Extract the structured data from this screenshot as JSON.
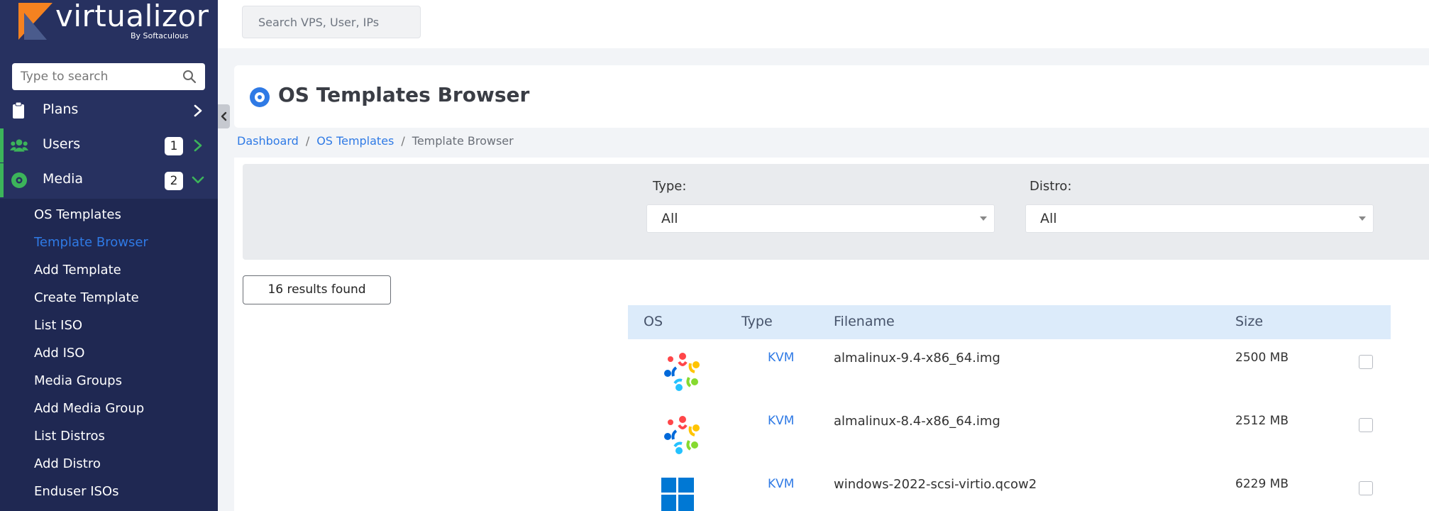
{
  "sidebar": {
    "brand": "virtualizor",
    "brand_sub": "By Softaculous",
    "search_placeholder": "Type to search",
    "nav": [
      {
        "label": "Plans",
        "icon": "clipboard-icon"
      },
      {
        "label": "Users",
        "icon": "users-icon",
        "badge": "1"
      },
      {
        "label": "Media",
        "icon": "disc-icon",
        "badge": "2"
      }
    ],
    "submenu": [
      {
        "label": "OS Templates"
      },
      {
        "label": "Template Browser",
        "active": true
      },
      {
        "label": "Add Template"
      },
      {
        "label": "Create Template"
      },
      {
        "label": "List ISO"
      },
      {
        "label": "Add ISO"
      },
      {
        "label": "Media Groups"
      },
      {
        "label": "Add Media Group"
      },
      {
        "label": "List Distros"
      },
      {
        "label": "Add Distro"
      },
      {
        "label": "Enduser ISOs"
      }
    ]
  },
  "topbar": {
    "search_placeholder": "Search VPS, User, IPs"
  },
  "page": {
    "title": "OS Templates Browser",
    "breadcrumb": [
      "Dashboard",
      "OS Templates",
      "Template Browser"
    ]
  },
  "filters": {
    "type_label": "Type:",
    "type_value": "All",
    "distro_label": "Distro:",
    "distro_value": "All"
  },
  "results_text": "16 results found",
  "table": {
    "headers": [
      "OS",
      "Type",
      "Filename",
      "Size"
    ],
    "rows": [
      {
        "os_icon": "almalinux-icon",
        "type": "KVM",
        "filename": "almalinux-9.4-x86_64.img",
        "size": "2500 MB"
      },
      {
        "os_icon": "almalinux-icon",
        "type": "KVM",
        "filename": "almalinux-8.4-x86_64.img",
        "size": "2512 MB"
      },
      {
        "os_icon": "windows-icon",
        "type": "KVM",
        "filename": "windows-2022-scsi-virtio.qcow2",
        "size": "6229 MB"
      }
    ]
  },
  "colors": {
    "sidebar_bg": "#273160",
    "submenu_bg": "#1f2852",
    "accent_blue": "#2f7ae5",
    "accent_green": "#3cb45a",
    "table_header_bg": "#dcebfa"
  }
}
